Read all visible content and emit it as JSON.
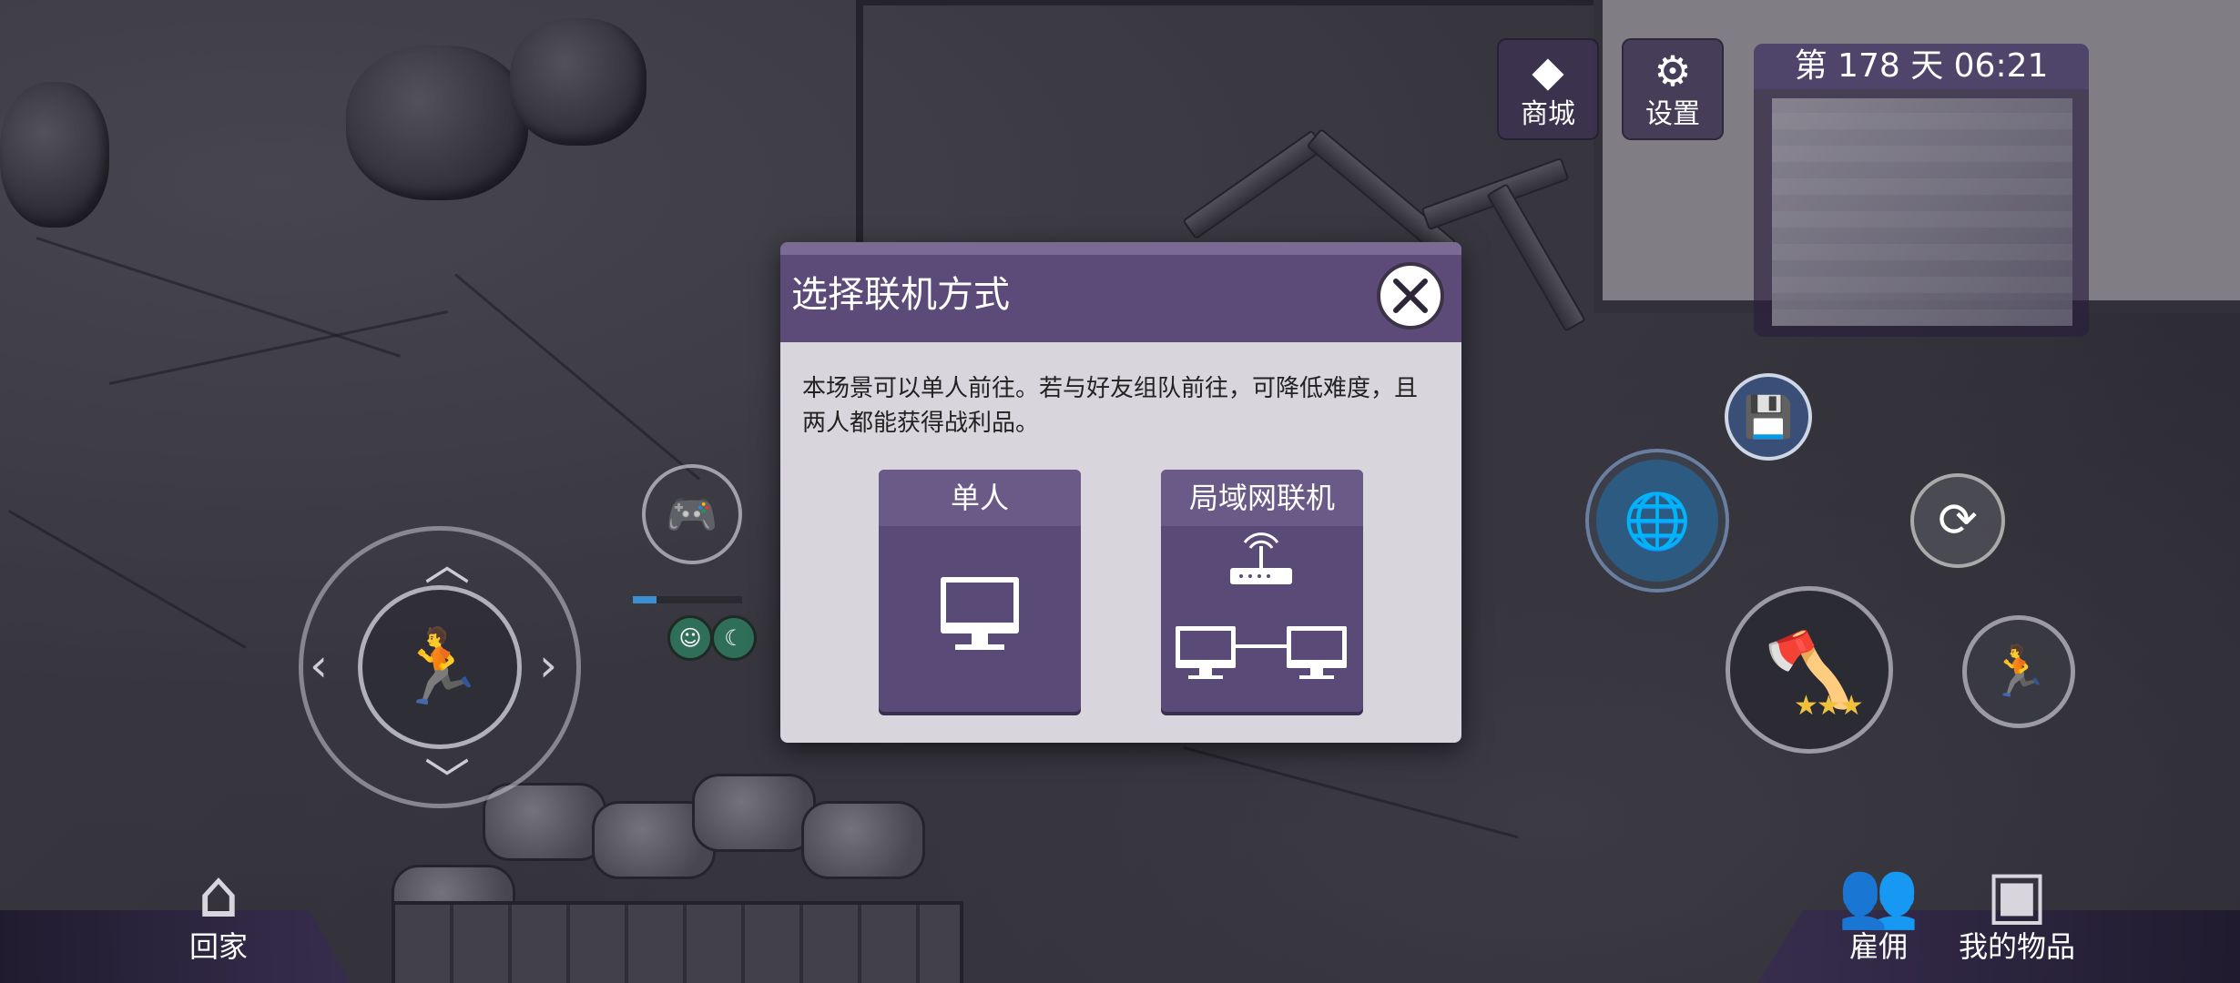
{
  "hud": {
    "shop_label": "商城",
    "settings_label": "设置",
    "day_time": "第 178 天  06:21"
  },
  "modal": {
    "title": "选择联机方式",
    "description": "本场景可以单人前往。若与好友组队前往，可降低难度，且两人都能获得战利品。",
    "options": [
      {
        "label": "单人",
        "icon": "monitor-icon"
      },
      {
        "label": "局域网联机",
        "icon": "lan-network-icon"
      }
    ]
  },
  "bottom": {
    "home_label": "回家",
    "hire_label": "雇佣",
    "items_label": "我的物品"
  },
  "player": {
    "health_fraction": 0.22
  },
  "weapon": {
    "stars": "★★★",
    "stars_count": 3
  },
  "colors": {
    "modal_header": "#5c4b78",
    "option_tile": "#5a4a78",
    "modal_body": "#d8d6dc",
    "star": "#f0c23c"
  }
}
